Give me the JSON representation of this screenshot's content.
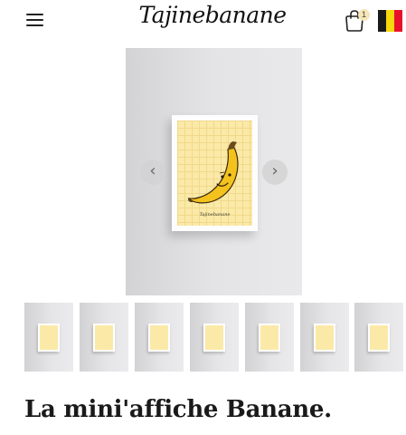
{
  "header": {
    "logo_text": "Tajinebanane",
    "cart_count": "1",
    "menu_icon": "hamburger-menu-icon",
    "cart_icon": "shopping-bag-icon",
    "flag_icon": "belgium-flag-icon",
    "flag_colors": [
      "#1a1a1a",
      "#f5d90a",
      "#e8112d"
    ]
  },
  "gallery": {
    "prev_symbol": "‹",
    "next_symbol": "›",
    "poster_signature": "Tajinebanane",
    "poster_background": "#fbe9a8",
    "thumbnail_count": 7
  },
  "product": {
    "title": "La mini'affiche Banane."
  }
}
